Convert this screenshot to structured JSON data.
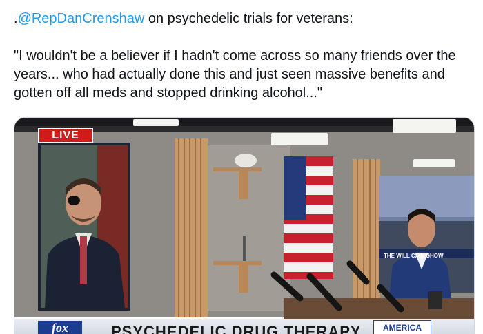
{
  "tweet": {
    "prefix": ".",
    "mention": "@RepDanCrenshaw",
    "intro": " on psychedelic trials for veterans:",
    "quote": "\"I wouldn't be a believer if I hadn't come across so many friends over the years... who had actually done this and just seen massive benefits and gotten off all meds and stopped drinking alcohol...\""
  },
  "media": {
    "live_badge": "LIVE",
    "network_logo": "fox",
    "headline": "PSYCHEDELIC DRUG THERAPY",
    "show_tag": "AMERICA",
    "screen_text": "THE WILL CAIN SHOW"
  }
}
